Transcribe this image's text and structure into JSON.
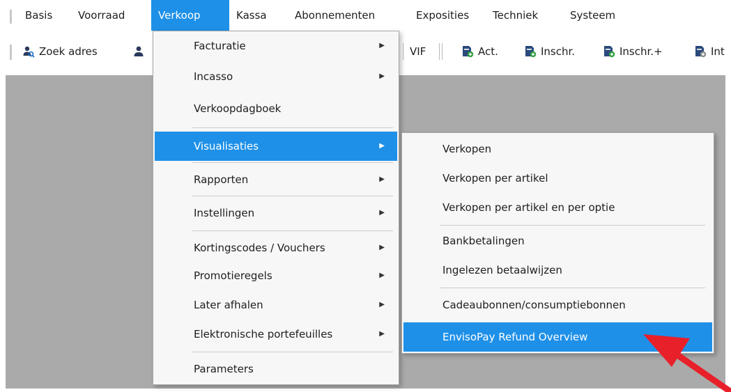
{
  "menubar": {
    "items": [
      {
        "label": "Basis"
      },
      {
        "label": "Voorraad"
      },
      {
        "label": "Verkoop"
      },
      {
        "label": "Kassa"
      },
      {
        "label": "Abonnementen"
      },
      {
        "label": "Exposities"
      },
      {
        "label": "Techniek"
      },
      {
        "label": "Systeem"
      }
    ]
  },
  "toolbar": {
    "zoek_adres": "Zoek adres",
    "vif": "VIF",
    "act": "Act.",
    "inschr": "Inschr.",
    "inschr_plus": "Inschr.+",
    "int": "Int"
  },
  "verkoop_menu": {
    "items": [
      {
        "label": "Facturatie"
      },
      {
        "label": "Incasso"
      },
      {
        "label": "Verkoopdagboek"
      },
      {
        "label": "Visualisaties"
      },
      {
        "label": "Rapporten"
      },
      {
        "label": "Instellingen"
      },
      {
        "label": "Kortingscodes / Vouchers"
      },
      {
        "label": "Promotieregels"
      },
      {
        "label": "Later afhalen"
      },
      {
        "label": "Elektronische portefeuilles"
      },
      {
        "label": "Parameters"
      }
    ]
  },
  "visualisaties_menu": {
    "items": [
      {
        "label": "Verkopen"
      },
      {
        "label": "Verkopen per artikel"
      },
      {
        "label": "Verkopen per artikel en per optie"
      },
      {
        "label": "Bankbetalingen"
      },
      {
        "label": "Ingelezen betaalwijzen"
      },
      {
        "label": "Cadeaubonnen/consumptiebonnen"
      },
      {
        "label": "EnvisoPay Refund Overview"
      }
    ]
  },
  "colors": {
    "highlight": "#1e90e8",
    "workspace": "#aaaaaa",
    "annotation_arrow": "#e8202a"
  },
  "icons": {
    "zoek_adres": "person-search-icon",
    "person": "person-icon",
    "act": "document-add-icon",
    "arrow": "red-pointer-arrow"
  }
}
